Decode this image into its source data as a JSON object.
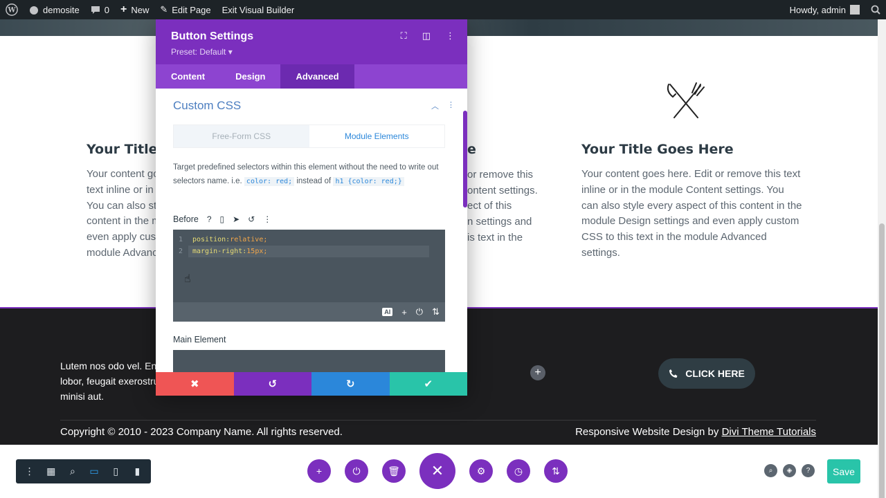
{
  "admin_bar": {
    "site_name": "demosite",
    "comments_count": "0",
    "new_label": "New",
    "edit_page_label": "Edit Page",
    "exit_label": "Exit Visual Builder",
    "greeting": "Howdy, admin"
  },
  "modal": {
    "title": "Button Settings",
    "preset": "Preset: Default",
    "tabs": [
      "Content",
      "Design",
      "Advanced"
    ],
    "active_tab": "Advanced",
    "section_title": "Custom CSS",
    "subtabs": [
      "Free-Form CSS",
      "Module Elements"
    ],
    "description_prefix": "Target predefined selectors within this element without the need to write out selectors name. i.e.",
    "code_example_1": "color: red;",
    "description_middle": "instead of",
    "code_example_2": "h1 {color: red;}",
    "before_label": "Before",
    "code_lines": [
      {
        "num": "1",
        "prop": "position:",
        "val": "relative;"
      },
      {
        "num": "2",
        "prop": "margin-right:",
        "val": "15px;"
      }
    ],
    "ai_label": "AI",
    "main_element_label": "Main Element"
  },
  "page": {
    "col1_title": "Your Title",
    "col1_lines": [
      "Your content go",
      "text inline or in",
      "You can also st",
      "content in the m",
      "even apply cust",
      "module Advanc"
    ],
    "col2_title": "e",
    "col2_lines": [
      "or remove this",
      "ontent settings.",
      "ect of this",
      "n settings and",
      "is text in the"
    ],
    "col3_title": "Your Title Goes Here",
    "col3_body": "Your content goes here. Edit or remove this text inline or in the module Content settings. You can also style every aspect of this content in the module Design settings and even apply custom CSS to this text in the module Advanced settings."
  },
  "footer": {
    "body_text": "Lutem nos odo vel. Eni lobor, feugait exerostru minisi aut.",
    "cta_label": "CLICK HERE",
    "copyright": "Copyright © 2010 - 2023 Company Name. All rights reserved.",
    "credit_prefix": "Responsive Website Design by",
    "credit_link": "Divi Theme Tutorials"
  },
  "bottom_bar": {
    "save_label": "Save"
  },
  "colors": {
    "purple": "#7b2fbe",
    "blue": "#2b87da",
    "teal": "#29c4a9",
    "red": "#ef5555",
    "admin_bar": "#1d2327"
  }
}
